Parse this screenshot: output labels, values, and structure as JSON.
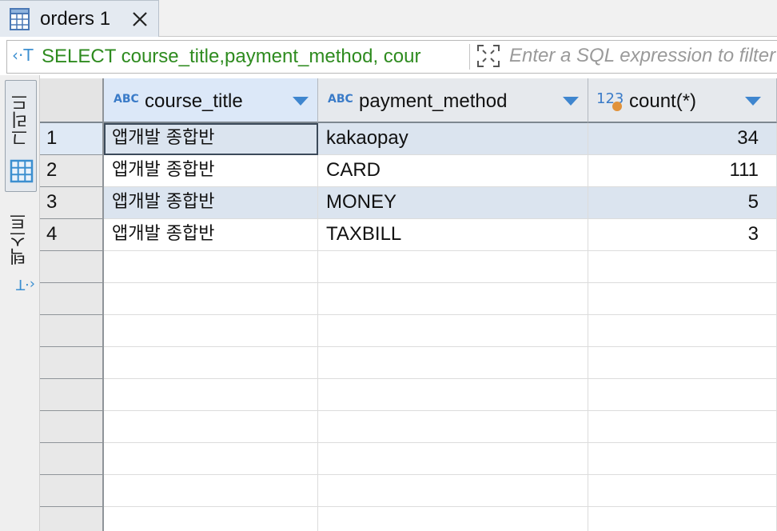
{
  "tab": {
    "label": "orders 1"
  },
  "filter": {
    "sql": "SELECT course_title,payment_method, cour",
    "placeholder": "Enter a SQL expression to filter results (use Ctrl+Space)"
  },
  "side_panel": {
    "grid_label": "그리드",
    "text_label": "텍스트"
  },
  "columns": [
    {
      "type": "ABC",
      "name": "course_title"
    },
    {
      "type": "ABC",
      "name": "payment_method"
    },
    {
      "type": "123",
      "name": "count(*)"
    }
  ],
  "rows": [
    {
      "n": "1",
      "course_title": "앱개발 종합반",
      "payment_method": "kakaopay",
      "count": "34"
    },
    {
      "n": "2",
      "course_title": "앱개발 종합반",
      "payment_method": "CARD",
      "count": "111"
    },
    {
      "n": "3",
      "course_title": "앱개발 종합반",
      "payment_method": "MONEY",
      "count": "5"
    },
    {
      "n": "4",
      "course_title": "앱개발 종합반",
      "payment_method": "TAXBILL",
      "count": "3"
    }
  ],
  "colors": {
    "sql_text": "#2e8b1f",
    "accent": "#3f86cf",
    "row_alt": "#dbe4ef",
    "number_dot": "#e1923a"
  }
}
